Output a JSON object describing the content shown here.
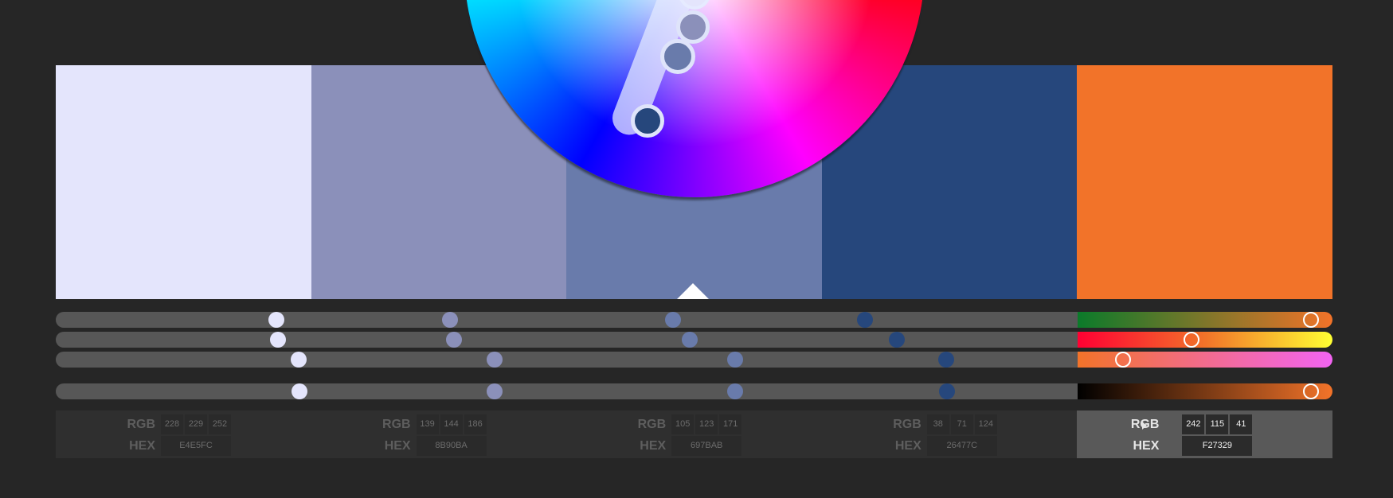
{
  "colors": [
    {
      "rgb": [
        "228",
        "229",
        "252"
      ],
      "hex": "E4E5FC",
      "color": "#E4E5FC"
    },
    {
      "rgb": [
        "139",
        "144",
        "186"
      ],
      "hex": "8B90BA",
      "color": "#8B90BA"
    },
    {
      "rgb": [
        "105",
        "123",
        "171"
      ],
      "hex": "697BAB",
      "color": "#697BAB"
    },
    {
      "rgb": [
        "38",
        "71",
        "124"
      ],
      "hex": "26477C",
      "color": "#26477C"
    },
    {
      "rgb": [
        "242",
        "115",
        "41"
      ],
      "hex": "F27329",
      "color": "#F27329"
    }
  ],
  "labels": {
    "rgb": "RGB",
    "hex": "HEX"
  },
  "selected_index": 4,
  "active_slider_gradients": {
    "row1": "linear-gradient(to right, #0b7a2a, #f27329)",
    "row2": "linear-gradient(to right, #ff0033, #f27329, #ffff33)",
    "row3": "linear-gradient(to right, #f27329, #f264f2)",
    "row4": "linear-gradient(to right, #000000, #f27329)"
  }
}
